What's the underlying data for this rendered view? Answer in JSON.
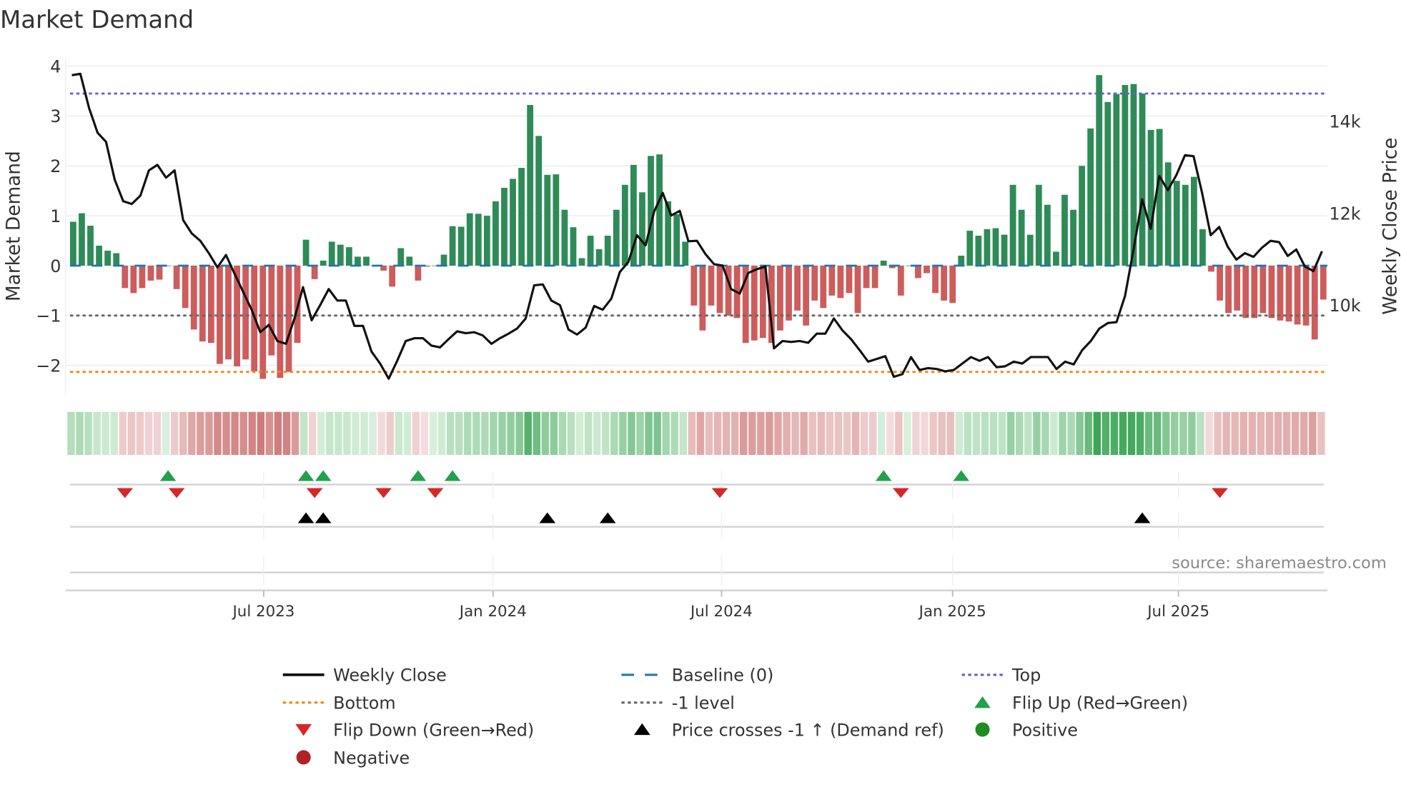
{
  "chart_data": {
    "type": "bar",
    "title": "Market Demand",
    "ylabel": "Market Demand",
    "y2label": "Weekly Close Price",
    "ylim": [
      -2.6,
      4.1
    ],
    "yticks": [
      {
        "v": 4,
        "label": "4"
      },
      {
        "v": 3,
        "label": "3"
      },
      {
        "v": 2,
        "label": "2"
      },
      {
        "v": 1,
        "label": "1"
      },
      {
        "v": 0,
        "label": "0"
      },
      {
        "v": -1,
        "label": "−1"
      },
      {
        "v": -2,
        "label": "−2"
      }
    ],
    "y2ticks": [
      {
        "v": 14000,
        "label": "14k"
      },
      {
        "v": 12000,
        "label": "12k"
      },
      {
        "v": 10000,
        "label": "10k"
      }
    ],
    "xticks": [
      {
        "week": 22.1,
        "label": "Jul 2023"
      },
      {
        "week": 48.7,
        "label": "Jan 2024"
      },
      {
        "week": 75.2,
        "label": "Jul 2024"
      },
      {
        "week": 102,
        "label": "Jan 2025"
      },
      {
        "week": 128.2,
        "label": "Jul 2025"
      }
    ],
    "reference_lines": {
      "top": 3.45,
      "bottom": -2.13,
      "minus_one": -1,
      "baseline": 0
    },
    "demand": [
      0.88,
      1.05,
      0.8,
      0.4,
      0.3,
      0.25,
      -0.45,
      -0.55,
      -0.45,
      -0.3,
      -0.28,
      0,
      -0.47,
      -0.85,
      -1.28,
      -1.52,
      -1.55,
      -1.97,
      -1.88,
      -2.02,
      -1.88,
      -2.12,
      -2.27,
      -1.8,
      -2.25,
      -2.13,
      -1.55,
      0.52,
      -0.27,
      0.1,
      0.48,
      0.42,
      0.37,
      0.18,
      0.18,
      0,
      -0.1,
      -0.42,
      0.35,
      0.18,
      -0.3,
      -0.02,
      0,
      0.22,
      0.79,
      0.78,
      1.05,
      1.04,
      1.0,
      1.29,
      1.56,
      1.74,
      1.96,
      3.22,
      2.6,
      1.82,
      1.83,
      1.12,
      0.77,
      0.15,
      0.6,
      0.33,
      0.6,
      1.12,
      1.62,
      2.02,
      1.47,
      2.2,
      2.23,
      1.29,
      1.03,
      0.48,
      -0.8,
      -1.3,
      -0.8,
      -0.95,
      -1.0,
      -1.05,
      -1.55,
      -1.5,
      -1.45,
      -1.55,
      -1.3,
      -1.1,
      -0.9,
      -1.2,
      -0.7,
      -0.85,
      -0.6,
      -0.65,
      -0.55,
      -0.95,
      -0.45,
      -0.45,
      0.1,
      -0.05,
      -0.6,
      0,
      -0.25,
      -0.15,
      -0.55,
      -0.7,
      -0.75,
      0.2,
      0.7,
      0.6,
      0.73,
      0.75,
      0.62,
      1.62,
      1.12,
      0.62,
      1.62,
      1.22,
      0.28,
      1.42,
      1.12,
      2.0,
      2.75,
      3.82,
      3.28,
      3.44,
      3.62,
      3.64,
      3.45,
      2.72,
      2.74,
      2.07,
      1.7,
      1.62,
      1.78,
      0.73,
      -0.12,
      -0.7,
      -0.95,
      -0.9,
      -1.05,
      -1.05,
      -0.95,
      -1.05,
      -1.1,
      -1.12,
      -1.18,
      -1.2,
      -1.48,
      -0.68
    ],
    "weekly_close": [
      15000,
      15030,
      14290,
      13750,
      13550,
      12730,
      12260,
      12200,
      12380,
      12930,
      13050,
      12770,
      12930,
      11850,
      11560,
      11400,
      11130,
      10820,
      11090,
      10680,
      10290,
      9900,
      9410,
      9570,
      9220,
      9160,
      9710,
      10390,
      9670,
      10000,
      10350,
      10100,
      10100,
      9550,
      9550,
      8990,
      8730,
      8400,
      8790,
      9220,
      9280,
      9280,
      9120,
      9080,
      9260,
      9430,
      9390,
      9410,
      9340,
      9160,
      9280,
      9380,
      9490,
      9710,
      10430,
      10450,
      10100,
      10000,
      9470,
      9360,
      9510,
      9980,
      9900,
      10140,
      10720,
      10940,
      11520,
      11300,
      12030,
      12440,
      11950,
      12050,
      11390,
      11400,
      11110,
      10890,
      10860,
      10350,
      10250,
      10700,
      10780,
      10840,
      9060,
      9220,
      9200,
      9220,
      9180,
      9380,
      9380,
      9710,
      9450,
      9260,
      9020,
      8770,
      8830,
      8890,
      8440,
      8500,
      8870,
      8590,
      8630,
      8610,
      8560,
      8590,
      8730,
      8870,
      8790,
      8870,
      8650,
      8670,
      8770,
      8730,
      8870,
      8870,
      8870,
      8610,
      8770,
      8710,
      9020,
      9220,
      9490,
      9610,
      9630,
      10200,
      11210,
      12300,
      11660,
      12810,
      12500,
      12830,
      13260,
      13240,
      12440,
      11520,
      11700,
      11270,
      10990,
      11130,
      11050,
      11250,
      11400,
      11370,
      11070,
      11210,
      10840,
      10740,
      11170
    ],
    "flip_up_weeks": [
      11,
      27,
      29,
      40,
      44,
      94,
      103
    ],
    "flip_down_weeks": [
      6,
      12,
      28,
      36,
      42,
      75,
      96,
      133
    ],
    "price_cross_weeks": [
      27,
      29,
      55,
      62,
      124
    ],
    "source": "source: sharemaestro.com",
    "legend": [
      {
        "label": "Weekly Close",
        "kind": "line",
        "color": "#111111"
      },
      {
        "label": "Baseline (0)",
        "kind": "dash",
        "color": "#1f77b4"
      },
      {
        "label": "Top",
        "kind": "dot",
        "color": "#6a5acd"
      },
      {
        "label": "Bottom",
        "kind": "dot",
        "color": "#ff7f0e"
      },
      {
        "label": "-1 level",
        "kind": "dot",
        "color": "#666666"
      },
      {
        "label": "Flip Up (Red→Green)",
        "kind": "up",
        "color": "#22a04b"
      },
      {
        "label": "Flip Down (Green→Red)",
        "kind": "down",
        "color": "#d62728"
      },
      {
        "label": "Price crosses -1 ↑ (Demand ref)",
        "kind": "up",
        "color": "#000000"
      },
      {
        "label": "Positive",
        "kind": "circle",
        "color": "#228b22"
      },
      {
        "label": "Negative",
        "kind": "circle",
        "color": "#b22222"
      }
    ],
    "colors": {
      "positive_bar": "#2e8b57",
      "negative_bar": "#cd5c5c",
      "top": "#6a5acd",
      "bottom": "#ff7f0e",
      "baseline": "#1f77b4",
      "minus_one": "#666666",
      "price": "#111111",
      "flip_up": "#22a04b",
      "flip_down": "#d62728",
      "cross": "#000000"
    }
  }
}
